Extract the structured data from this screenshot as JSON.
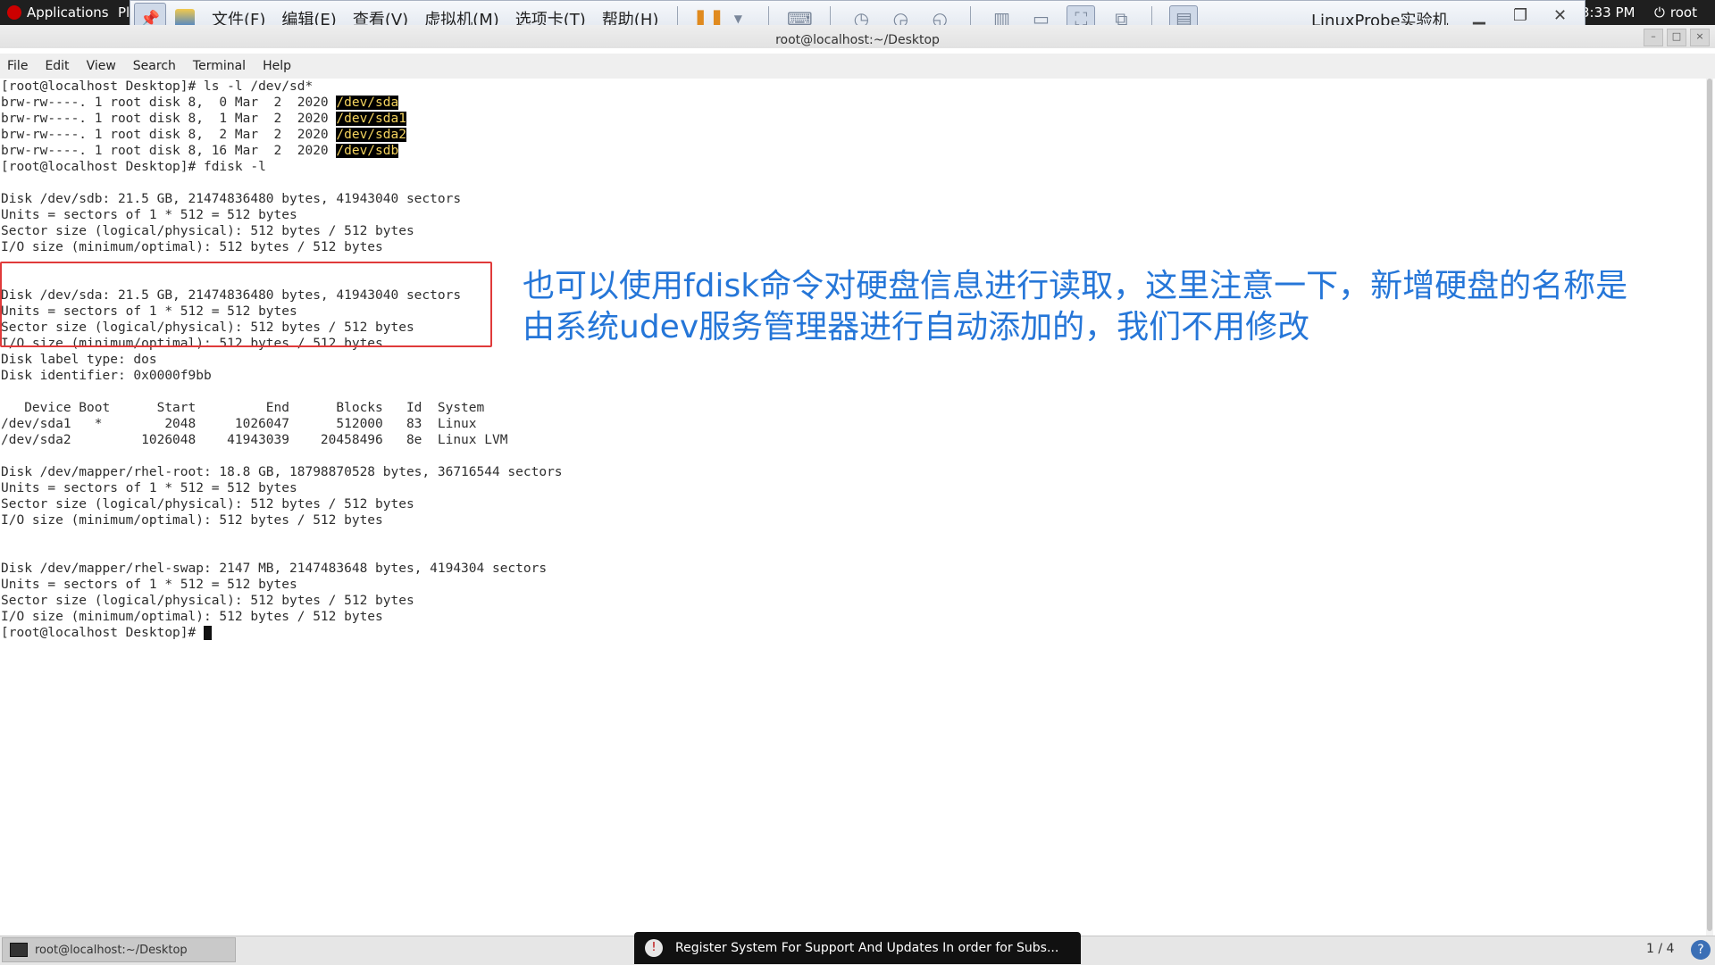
{
  "topbar": {
    "applications_label": "Applications",
    "places_label": "Pl",
    "clock": "3:33 PM",
    "user": "root"
  },
  "vmware": {
    "menus": [
      "文件(F)",
      "编辑(E)",
      "查看(V)",
      "虚拟机(M)",
      "选项卡(T)",
      "帮助(H)"
    ],
    "vm_name": "LinuxProbe实验机"
  },
  "terminal": {
    "window_title": "root@localhost:~/Desktop",
    "menu": [
      "File",
      "Edit",
      "View",
      "Search",
      "Terminal",
      "Help"
    ],
    "lines_ls": [
      {
        "prefix": "[root@localhost Desktop]# ls -l /dev/sd*",
        "dev": ""
      },
      {
        "prefix": "brw-rw----. 1 root disk 8,  0 Mar  2  2020 ",
        "dev": "/dev/sda"
      },
      {
        "prefix": "brw-rw----. 1 root disk 8,  1 Mar  2  2020 ",
        "dev": "/dev/sda1"
      },
      {
        "prefix": "brw-rw----. 1 root disk 8,  2 Mar  2  2020 ",
        "dev": "/dev/sda2"
      },
      {
        "prefix": "brw-rw----. 1 root disk 8, 16 Mar  2  2020 ",
        "dev": "/dev/sdb"
      }
    ],
    "fdisk_cmd": "[root@localhost Desktop]# fdisk -l",
    "output_rest": "\nDisk /dev/sdb: 21.5 GB, 21474836480 bytes, 41943040 sectors\nUnits = sectors of 1 * 512 = 512 bytes\nSector size (logical/physical): 512 bytes / 512 bytes\nI/O size (minimum/optimal): 512 bytes / 512 bytes\n\n\nDisk /dev/sda: 21.5 GB, 21474836480 bytes, 41943040 sectors\nUnits = sectors of 1 * 512 = 512 bytes\nSector size (logical/physical): 512 bytes / 512 bytes\nI/O size (minimum/optimal): 512 bytes / 512 bytes\nDisk label type: dos\nDisk identifier: 0x0000f9bb\n\n   Device Boot      Start         End      Blocks   Id  System\n/dev/sda1   *        2048     1026047      512000   83  Linux\n/dev/sda2         1026048    41943039    20458496   8e  Linux LVM\n\nDisk /dev/mapper/rhel-root: 18.8 GB, 18798870528 bytes, 36716544 sectors\nUnits = sectors of 1 * 512 = 512 bytes\nSector size (logical/physical): 512 bytes / 512 bytes\nI/O size (minimum/optimal): 512 bytes / 512 bytes\n\n\nDisk /dev/mapper/rhel-swap: 2147 MB, 2147483648 bytes, 4194304 sectors\nUnits = sectors of 1 * 512 = 512 bytes\nSector size (logical/physical): 512 bytes / 512 bytes\nI/O size (minimum/optimal): 512 bytes / 512 bytes\n",
    "prompt_final": "[root@localhost Desktop]# "
  },
  "annotation": {
    "text": "也可以使用fdisk命令对硬盘信息进行读取，这里注意一下，新增硬盘的名称是由系统udev服务管理器进行自动添加的，我们不用修改",
    "color": "#2576d8",
    "box_color": "#e03a3a"
  },
  "taskbar": {
    "task_label": "root@localhost:~/Desktop",
    "notification": "Register System For Support And Updates  In order for Subs...",
    "pager": "1 / 4"
  }
}
